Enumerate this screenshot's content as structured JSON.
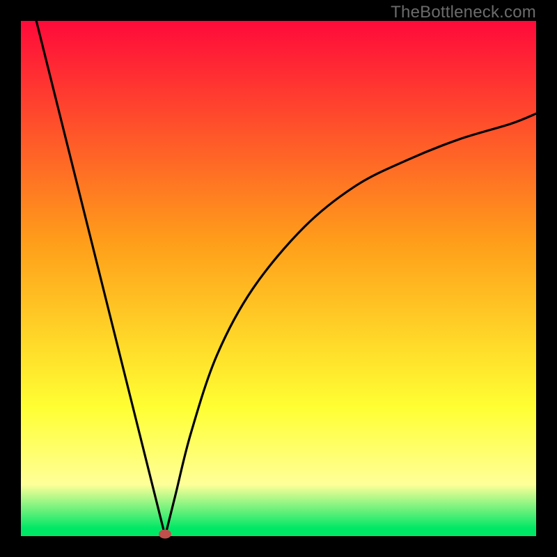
{
  "watermark": "TheBottleneck.com",
  "colors": {
    "red": "#ff0a3a",
    "orange": "#ff9e1a",
    "yellow": "#ffff33",
    "paleyellow": "#ffff99",
    "green": "#00e766",
    "dot": "#c1504d",
    "curve": "#000000",
    "frame": "#000000"
  },
  "chart_data": {
    "type": "line",
    "title": "",
    "xlabel": "",
    "ylabel": "",
    "xlim": [
      0,
      100
    ],
    "ylim": [
      0,
      100
    ],
    "notes": "V-shaped bottleneck curve on a red→green vertical gradient. Minimum (optimal point) occurs around x≈28, y≈0. Left branch is steep/nearly linear from (3,100) to (28,0). Right branch rises concavely toward (100,~82). Values estimated from pixel positions against plot extent.",
    "series": [
      {
        "name": "bottleneck-curve",
        "x": [
          3,
          8,
          13,
          18,
          23,
          26,
          28,
          30,
          33,
          38,
          45,
          55,
          65,
          75,
          85,
          95,
          100
        ],
        "values": [
          100,
          80,
          60,
          40,
          20,
          8,
          0,
          8,
          20,
          35,
          48,
          60,
          68,
          73,
          77,
          80,
          82
        ]
      }
    ],
    "optimal_point": {
      "x": 28,
      "y": 0
    }
  }
}
